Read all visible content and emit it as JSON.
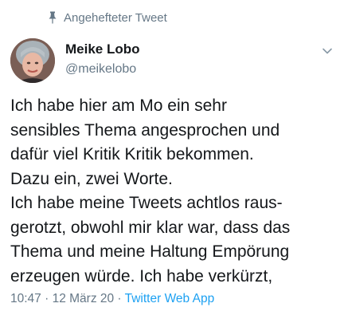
{
  "pinned": {
    "label": "Angehefteter Tweet",
    "icon": "pin-icon"
  },
  "author": {
    "name": "Meike Lobo",
    "handle": "@meikelobo",
    "avatar": "avatar-photo"
  },
  "tweet": {
    "lines": [
      "Ich habe hier am Mo ein sehr",
      "sensibles Thema angesprochen und",
      "dafür viel Kritik Kritik bekommen.",
      "Dazu ein, zwei Worte.",
      "Ich habe meine Tweets achtlos raus-",
      "gerotzt, obwohl mir klar war, dass das",
      "Thema und meine Haltung Empörung",
      "erzeugen würde. Ich habe verkürzt,"
    ]
  },
  "meta": {
    "time": "10:47",
    "sep1": " · ",
    "date": "12 März 20",
    "sep2": " · ",
    "source": "Twitter Web App"
  },
  "colors": {
    "text": "#14171a",
    "secondary": "#657786",
    "link": "#1da1f2"
  },
  "menu": {
    "icon": "chevron-down-icon"
  }
}
